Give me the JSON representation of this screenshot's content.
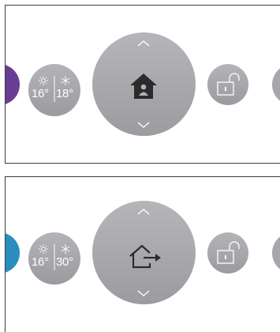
{
  "panels": [
    {
      "mode": "home",
      "mode_icon": "home-person-icon",
      "left_neighbor_color": "#6a3d94",
      "heat_setpoint": "16°",
      "cool_setpoint": "18°",
      "lock_icon": "unlocked-padlock-icon"
    },
    {
      "mode": "away",
      "mode_icon": "leave-home-icon",
      "left_neighbor_color": "#2b8dbd",
      "heat_setpoint": "16°",
      "cool_setpoint": "30°",
      "lock_icon": "unlocked-padlock-icon"
    }
  ],
  "colors": {
    "button_gray": "#a7a7ab",
    "icon_dark": "#2b2b2b",
    "icon_white": "#ffffff"
  }
}
